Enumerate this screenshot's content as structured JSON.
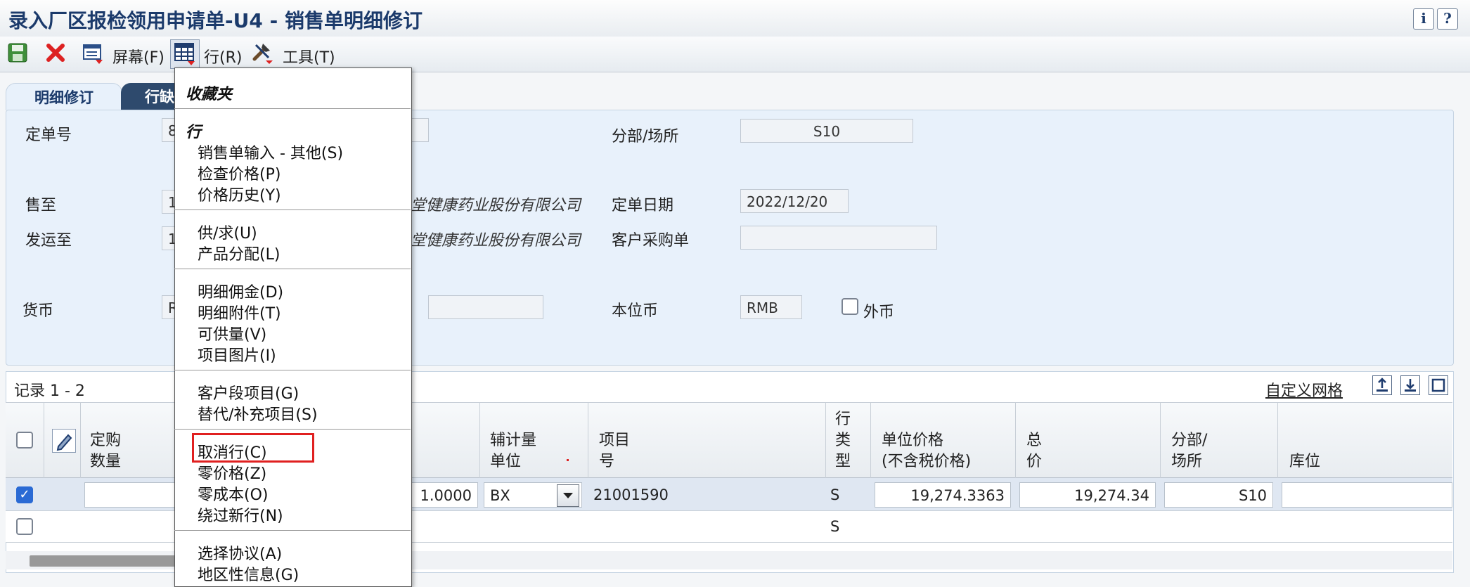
{
  "window": {
    "title": "录入厂区报检领用申请单-U4 - 销售单明细修订",
    "info_btn": "i",
    "help_btn": "?"
  },
  "toolbar": {
    "screen_label": "屏幕(F)",
    "row_label": "行(R)",
    "tools_label": "工具(T)"
  },
  "tabs": [
    "明细修订",
    "行缺"
  ],
  "form": {
    "order_no_label": "定单号",
    "order_no_value": "8",
    "branch_label": "分部/场所",
    "branch_value": "S10",
    "sold_to_label": "售至",
    "sold_to_value": "1",
    "sold_to_name": "堂健康药业股份有限公司",
    "order_date_label": "定单日期",
    "order_date_value": "2022/12/20",
    "ship_to_label": "发运至",
    "ship_to_value": "1",
    "ship_to_name": "堂健康药业股份有限公司",
    "customer_po_label": "客户采购单",
    "customer_po_value": "",
    "currency_label": "货币",
    "currency_value": "R",
    "base_currency_label": "本位币",
    "base_currency_value": "RMB",
    "foreign_label": "外币"
  },
  "grid": {
    "records_label": "记录 1 - 2",
    "customize_label": "自定义网格",
    "headers": {
      "order_qty": [
        "定购",
        "数量"
      ],
      "sec_uom": [
        "辅计量",
        "单位"
      ],
      "item_no": [
        "项目",
        "号"
      ],
      "line_type": [
        "行",
        "类",
        "型"
      ],
      "unit_price": [
        "单位价格",
        "(不含税价格)"
      ],
      "total_price": [
        "总",
        "价"
      ],
      "branch": [
        "分部/",
        "场所"
      ],
      "location": [
        "库位"
      ]
    },
    "rows": [
      {
        "checked": true,
        "qty_hidden": "1.0000",
        "sec_uom": "BX",
        "item_no": "21001590",
        "line_type": "S",
        "unit_price": "19,274.3363",
        "total_price": "19,274.34",
        "branch": "S10"
      },
      {
        "checked": false,
        "line_type": "S"
      }
    ]
  },
  "menu": {
    "favorites": "收藏夹",
    "row_heading": "行",
    "group1": [
      "销售单输入 - 其他(S)",
      "检查价格(P)",
      "价格历史(Y)"
    ],
    "group2": [
      "供/求(U)",
      "产品分配(L)"
    ],
    "group3": [
      "明细佣金(D)",
      "明细附件(T)",
      "可供量(V)",
      "项目图片(I)"
    ],
    "group4": [
      "客户段项目(G)",
      "替代/补充项目(S)"
    ],
    "group5": [
      "取消行(C)",
      "零价格(Z)",
      "零成本(O)",
      "绕过新行(N)"
    ],
    "group6": [
      "选择协议(A)",
      "地区性信息(G)"
    ],
    "highlight_color": "#e02020"
  }
}
